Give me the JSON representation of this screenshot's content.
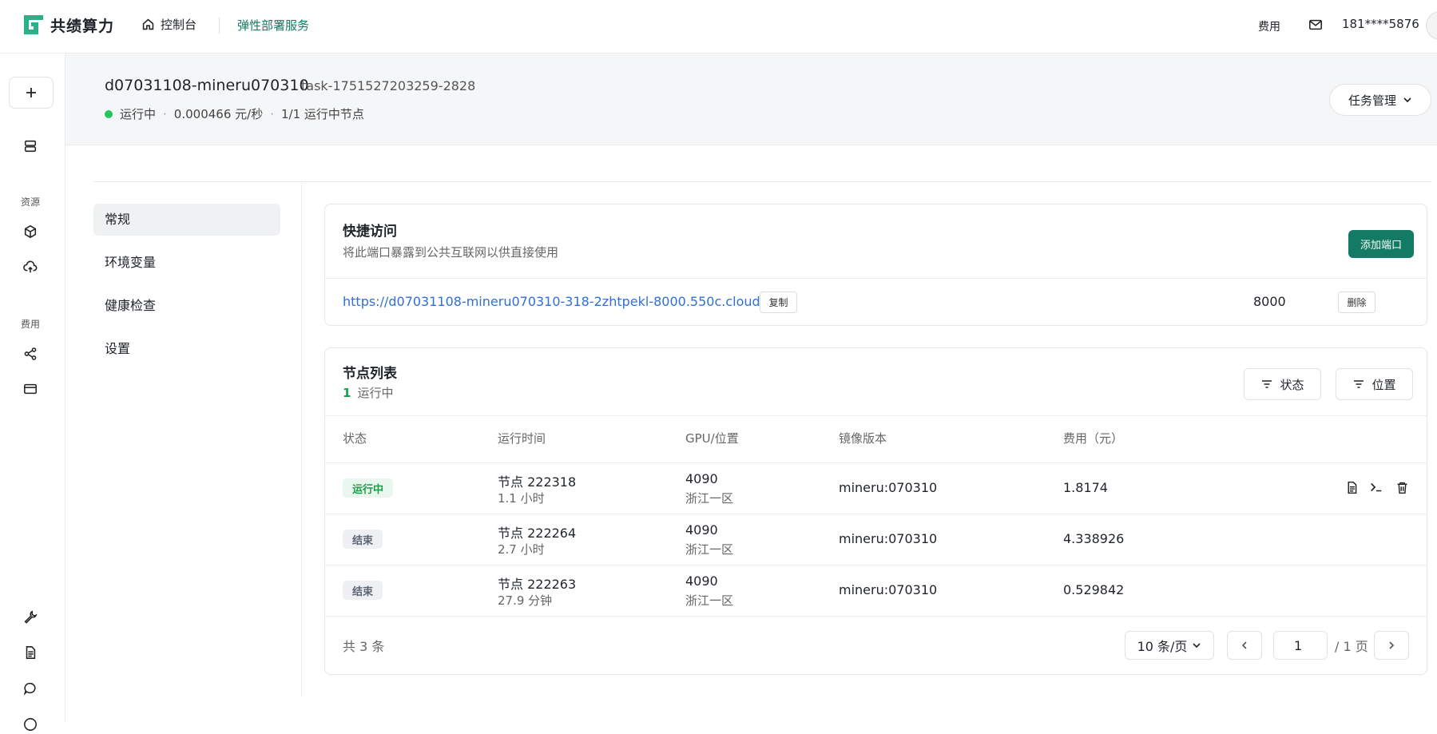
{
  "topbar": {
    "brand": "共绩算力",
    "console": "控制台",
    "elastic": "弹性部署服务",
    "fee": "费用",
    "user": "181****5876"
  },
  "rail": {
    "section_resource": "资源",
    "section_fee": "费用"
  },
  "header": {
    "job_name": "d07031108-mineru070310",
    "task_id": "task-1751527203259-2828",
    "status": "运行中",
    "price": "0.000466 元/秒",
    "nodes": "1/1 运行中节点",
    "task_manage": "任务管理"
  },
  "subnav": {
    "items": [
      {
        "label": "常规"
      },
      {
        "label": "环境变量"
      },
      {
        "label": "健康检查"
      },
      {
        "label": "设置"
      }
    ]
  },
  "quick_access": {
    "title": "快捷访问",
    "subtitle": "将此端口暴露到公共互联网以供直接使用",
    "add_port": "添加端口",
    "url": "https://d07031108-mineru070310-318-2zhtpekl-8000.550c.cloud",
    "copy": "复制",
    "port": "8000",
    "delete": "删除"
  },
  "node_list": {
    "title": "节点列表",
    "running_count": "1",
    "running_label": "运行中",
    "filter_status": "状态",
    "filter_location": "位置",
    "columns": [
      "状态",
      "运行时间",
      "GPU/位置",
      "镜像版本",
      "费用（元）"
    ],
    "rows": [
      {
        "status": "运行中",
        "node": "节点 222318",
        "duration": "1.1 小时",
        "gpu": "4090",
        "location": "浙江一区",
        "image": "mineru:070310",
        "cost": "1.8174"
      },
      {
        "status": "结束",
        "node": "节点 222264",
        "duration": "2.7 小时",
        "gpu": "4090",
        "location": "浙江一区",
        "image": "mineru:070310",
        "cost": "4.338926"
      },
      {
        "status": "结束",
        "node": "节点 222263",
        "duration": "27.9 分钟",
        "gpu": "4090",
        "location": "浙江一区",
        "image": "mineru:070310",
        "cost": "0.529842"
      }
    ]
  },
  "pager": {
    "total": "共 3 条",
    "page_size": "10 条/页",
    "current_page": "1",
    "of_pages": "/ 1 页"
  },
  "colors": {
    "brand_green": "#137a63",
    "status_green": "#22c55e",
    "link_blue": "#2f6fd6"
  }
}
